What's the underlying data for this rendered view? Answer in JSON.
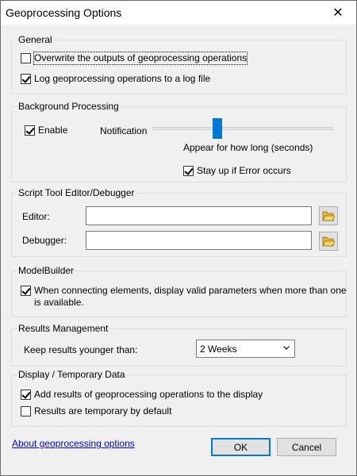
{
  "window": {
    "title": "Geoprocessing Options",
    "close_glyph": "✕"
  },
  "general": {
    "title": "General",
    "overwrite": {
      "label": "Overwrite the outputs of geoprocessing operations",
      "checked": false
    },
    "log": {
      "label": "Log geoprocessing operations to a log file",
      "checked": true
    }
  },
  "background": {
    "title": "Background Processing",
    "enable": {
      "label": "Enable",
      "checked": true
    },
    "notification_label": "Notification",
    "notification_level": 0.37,
    "duration_label": "Appear for how long (seconds)",
    "stay_up": {
      "label": "Stay up if Error occurs",
      "checked": true
    }
  },
  "script_tool": {
    "title": "Script Tool Editor/Debugger",
    "editor_label": "Editor:",
    "editor_value": "",
    "debugger_label": "Debugger:",
    "debugger_value": ""
  },
  "modelbuilder": {
    "title": "ModelBuilder",
    "display_valid": {
      "label_line1": "When connecting elements, display valid parameters when more than one",
      "label_line2": "is available.",
      "checked": true
    }
  },
  "results": {
    "title": "Results Management",
    "keep_label": "Keep results younger than:",
    "keep_value": "2 Weeks"
  },
  "display": {
    "title": "Display / Temporary Data",
    "add_results": {
      "label": "Add results of geoprocessing operations to the display",
      "checked": true
    },
    "temporary": {
      "label": "Results are temporary by default",
      "checked": false
    }
  },
  "footer": {
    "link": "About geoprocessing options",
    "ok": "OK",
    "cancel": "Cancel"
  },
  "colors": {
    "accent": "#0078d7",
    "link": "#0000ee",
    "folder": "#f5c542"
  },
  "icons": {
    "folder": "folder-open-icon",
    "dropdown": "chevron-down-icon",
    "close": "close-icon"
  }
}
